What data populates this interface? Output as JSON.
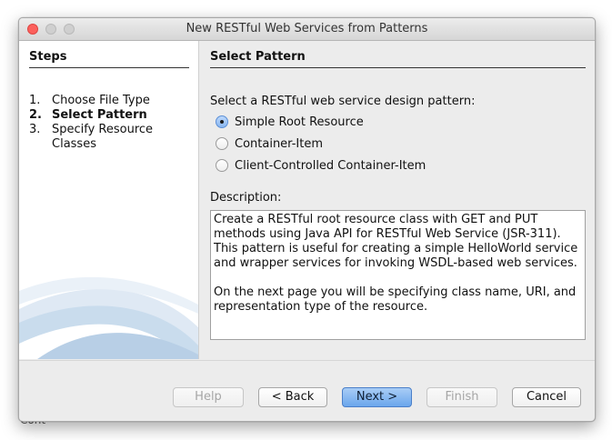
{
  "window": {
    "title": "New RESTful Web Services from Patterns"
  },
  "background": {
    "partial_text": "Cont"
  },
  "steps": {
    "heading": "Steps",
    "items": [
      {
        "num": "1.",
        "label": "Choose File Type"
      },
      {
        "num": "2.",
        "label": "Select Pattern"
      },
      {
        "num": "3.",
        "label": "Specify Resource",
        "label_cont": "Classes"
      }
    ],
    "current_index": 1
  },
  "main": {
    "heading": "Select Pattern",
    "prompt": "Select a RESTful web service design pattern:",
    "options": [
      {
        "label": "Simple Root Resource",
        "checked": true
      },
      {
        "label": "Container-Item",
        "checked": false
      },
      {
        "label": "Client-Controlled Container-Item",
        "checked": false
      }
    ],
    "description_label": "Description:",
    "description_p1": "Create a RESTful root resource class with GET and PUT methods using Java API for RESTful Web Service (JSR-311). This pattern is useful for creating a simple HelloWorld service and wrapper services for invoking WSDL-based web services.",
    "description_p2": "On the next page you will be specifying class name, URI, and representation type of the resource."
  },
  "buttons": {
    "help": "Help",
    "back": "< Back",
    "next": "Next >",
    "finish": "Finish",
    "cancel": "Cancel"
  },
  "colors": {
    "close_light": "#fc605c",
    "default_button": "#6aa6ec",
    "swoosh": "#c9dced"
  }
}
